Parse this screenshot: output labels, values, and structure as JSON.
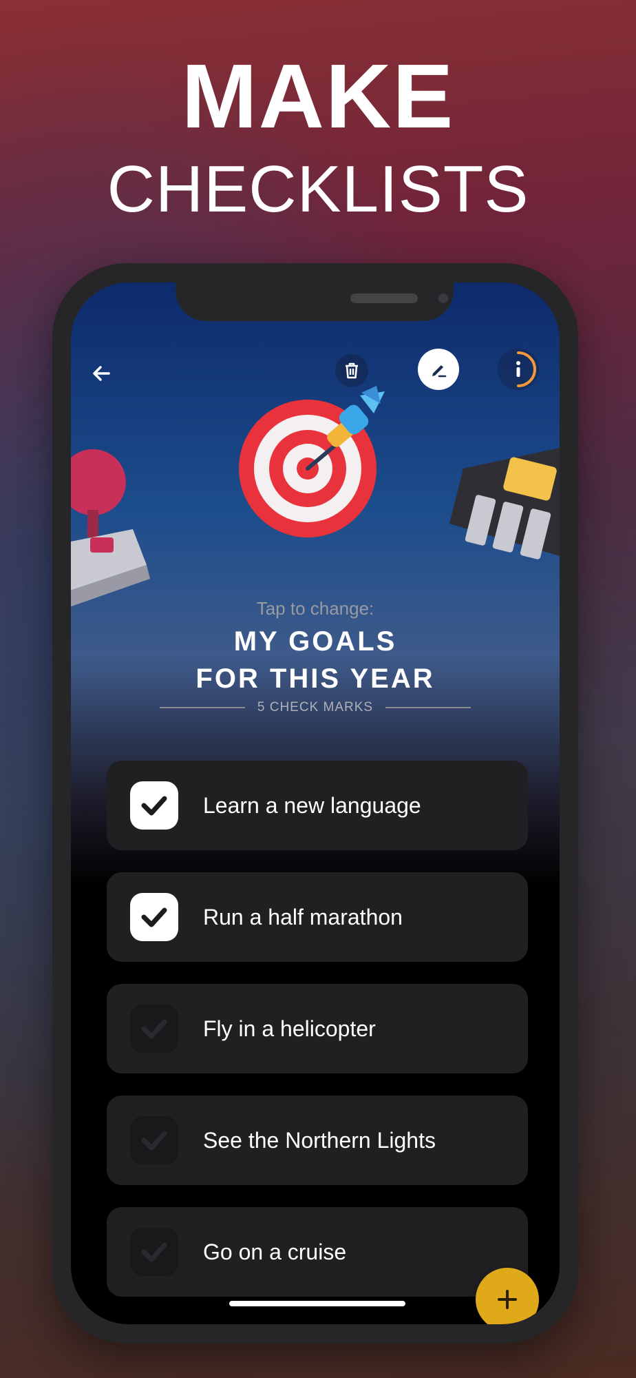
{
  "headline": {
    "line1": "MAKE",
    "line2": "CHECKLISTS"
  },
  "toolbar": {
    "back_icon": "arrow-left-icon",
    "delete_icon": "trash-icon",
    "edit_icon": "pencil-icon",
    "info_icon": "info-icon"
  },
  "list_header": {
    "hint": "Tap to change:",
    "title_line1": "MY GOALS",
    "title_line2": "FOR THIS YEAR",
    "count": "5 CHECK MARKS",
    "emoji": "dart-target-icon"
  },
  "items": [
    {
      "label": "Learn a new language",
      "checked": true
    },
    {
      "label": "Run a half marathon",
      "checked": true
    },
    {
      "label": "Fly in a helicopter",
      "checked": false
    },
    {
      "label": "See the Northern Lights",
      "checked": false
    },
    {
      "label": "Go on a cruise",
      "checked": false
    }
  ],
  "fab": {
    "icon": "plus-icon"
  },
  "colors": {
    "accent": "#e0a91a",
    "info_ring": "#f29a3a",
    "card": "#202022"
  }
}
